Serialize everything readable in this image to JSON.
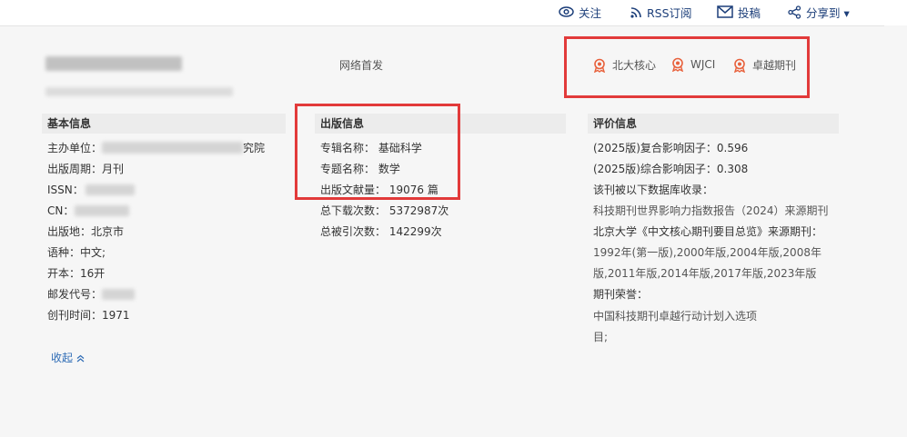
{
  "toolbar": {
    "follow": "关注",
    "rss": "RSS订阅",
    "submit": "投稿",
    "share": "分享到 ▾"
  },
  "journal": {
    "network_first": "网络首发"
  },
  "badges": [
    "北大核心",
    "WJCI",
    "卓越期刊"
  ],
  "basic": {
    "header": "基本信息",
    "sponsor_label": "主办单位：",
    "sponsor_value_tail": "究院",
    "period_label": "出版周期：",
    "period_value": "月刊",
    "issn_label": "ISSN：",
    "cn_label": "CN：",
    "place_label": "出版地：",
    "place_value": "北京市",
    "lang_label": "语种：",
    "lang_value": "中文;",
    "format_label": "开本：",
    "format_value": "16开",
    "post_label": "邮发代号：",
    "founded_label": "创刊时间：",
    "founded_value": "1971"
  },
  "publish": {
    "header": "出版信息",
    "album_label": "专辑名称：",
    "album_value": "基础科学",
    "topic_label": "专题名称：",
    "topic_value": "数学",
    "count_label": "出版文献量：",
    "count_value": "19076 篇",
    "downloads_label": "总下载次数：",
    "downloads_value": "5372987次",
    "citations_label": "总被引次数：",
    "citations_value": "142299次"
  },
  "eval": {
    "header": "评价信息",
    "composite_if": "(2025版)复合影响因子：0.596",
    "comprehensive_if": "(2025版)综合影响因子：0.308",
    "indexed_by": "该刊被以下数据库收录：",
    "wjci_source": "科技期刊世界影响力指数报告（2024）来源期刊",
    "pku_source": "北京大学《中文核心期刊要目总览》来源期刊：",
    "pku_years_1": "1992年(第一版),2000年版,2004年版,2008年",
    "pku_years_2": "版,2011年版,2014年版,2017年版,2023年版",
    "honors": "期刊荣誉：",
    "honor_1": "中国科技期刊卓越行动计划入选项",
    "honor_2": "目;"
  },
  "collapse_label": "收起",
  "colors": {
    "link": "#1d3f7a",
    "highlight": "#e23a3a",
    "badge_icon": "#e8613c"
  }
}
